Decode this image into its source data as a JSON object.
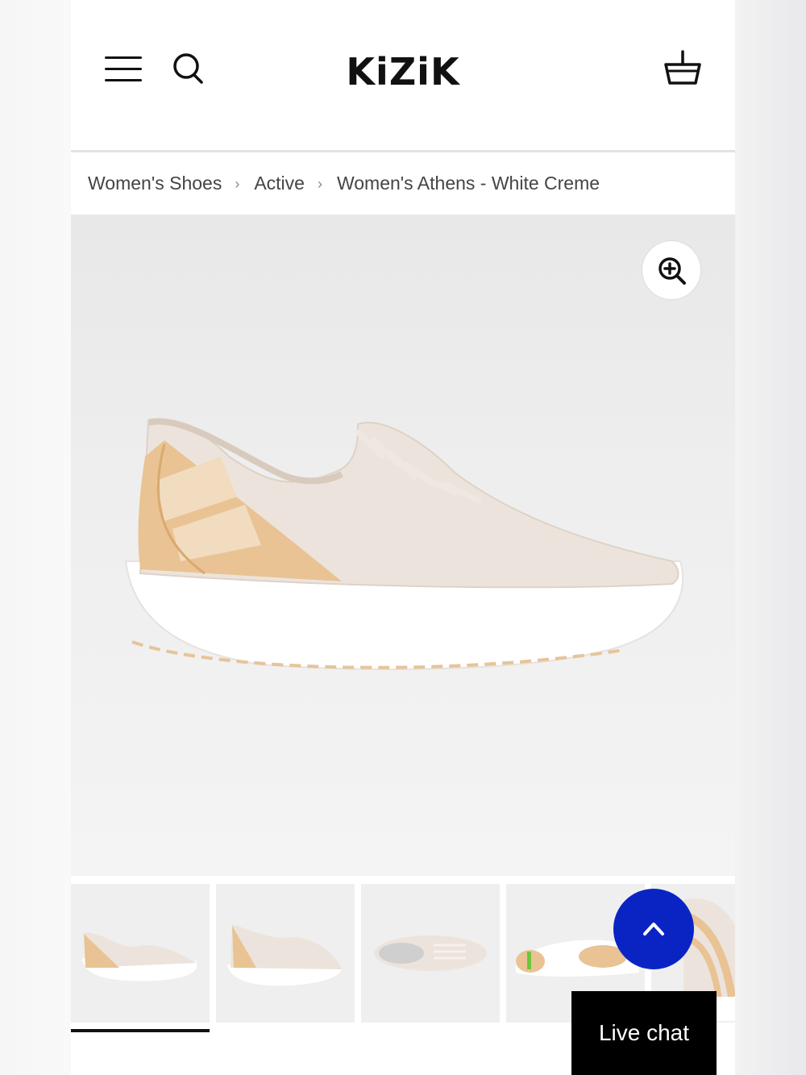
{
  "header": {
    "brand": "KiZiK",
    "menu_icon": "hamburger-icon",
    "search_icon": "search-icon",
    "cart_icon": "cart-basket-icon"
  },
  "breadcrumb": {
    "items": [
      "Women's Shoes",
      "Active",
      "Women's Athens - White Creme"
    ],
    "separator": "›"
  },
  "gallery": {
    "zoom_icon": "zoom-in-icon",
    "active_thumbnail": 1,
    "thumbnail_count": 5
  },
  "floating": {
    "scroll_top_icon": "chevron-up-icon",
    "live_chat_label": "Live chat"
  },
  "colors": {
    "accent_blue": "#0a24c4",
    "text_dark": "#111111",
    "shoe_upper": "#ece4dc",
    "shoe_heel": "#e9c394",
    "sole": "#ffffff"
  }
}
